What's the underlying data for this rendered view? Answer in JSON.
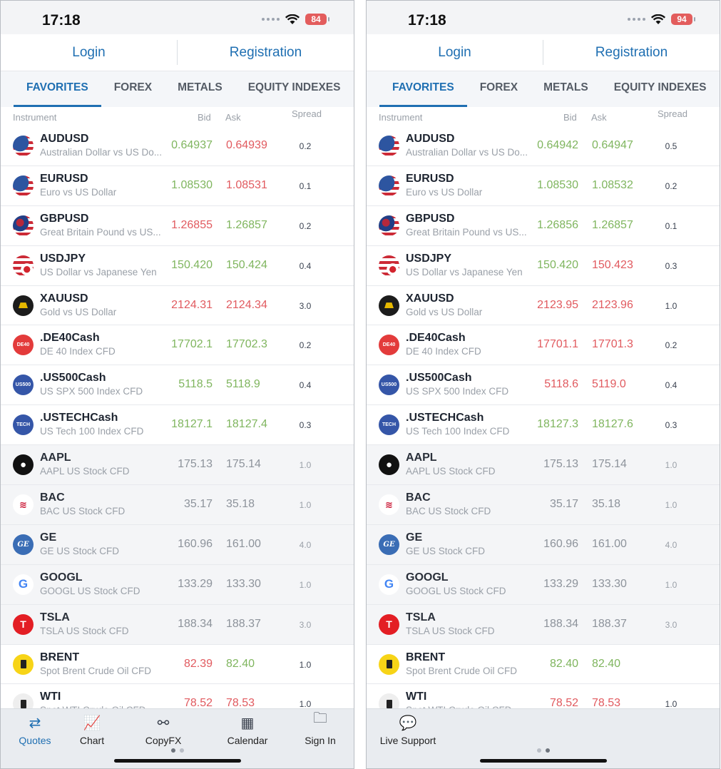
{
  "screens": [
    {
      "status": {
        "time": "17:18",
        "battery": "84"
      },
      "auth": {
        "login": "Login",
        "registration": "Registration"
      },
      "tabs": [
        "FAVORITES",
        "FOREX",
        "METALS",
        "EQUITY INDEXES"
      ],
      "columns": {
        "instrument": "Instrument",
        "bid": "Bid",
        "ask": "Ask",
        "spread": "Spread"
      },
      "rows": [
        {
          "icon": "usd-aud-flag-icon",
          "symbol": "AUDUSD",
          "desc": "Australian Dollar vs US Do...",
          "bid": "0.64937",
          "bid_dir": "up",
          "ask": "0.64939",
          "ask_dir": "down",
          "spread": "0.2"
        },
        {
          "icon": "eur-usd-flag-icon",
          "symbol": "EURUSD",
          "desc": "Euro vs US Dollar",
          "bid": "1.08530",
          "bid_dir": "up",
          "ask": "1.08531",
          "ask_dir": "down",
          "spread": "0.1"
        },
        {
          "icon": "gbp-usd-flag-icon",
          "symbol": "GBPUSD",
          "desc": "Great Britain Pound vs US...",
          "bid": "1.26855",
          "bid_dir": "down",
          "ask": "1.26857",
          "ask_dir": "up",
          "spread": "0.2"
        },
        {
          "icon": "usd-jpy-flag-icon",
          "symbol": "USDJPY",
          "desc": "US Dollar vs Japanese Yen",
          "bid": "150.420",
          "bid_dir": "up",
          "ask": "150.424",
          "ask_dir": "up",
          "spread": "0.4"
        },
        {
          "icon": "gold-bar-icon",
          "symbol": "XAUUSD",
          "desc": "Gold vs US Dollar",
          "bid": "2124.31",
          "bid_dir": "down",
          "ask": "2124.34",
          "ask_dir": "down",
          "spread": "3.0"
        },
        {
          "icon": "de40-index-icon",
          "symbol": ".DE40Cash",
          "desc": "DE 40 Index CFD",
          "bid": "17702.1",
          "bid_dir": "up",
          "ask": "17702.3",
          "ask_dir": "up",
          "spread": "0.2"
        },
        {
          "icon": "us500-index-icon",
          "symbol": ".US500Cash",
          "desc": "US SPX 500 Index CFD",
          "bid": "5118.5",
          "bid_dir": "up",
          "ask": "5118.9",
          "ask_dir": "up",
          "spread": "0.4"
        },
        {
          "icon": "ustech-index-icon",
          "symbol": ".USTECHCash",
          "desc": "US Tech 100 Index CFD",
          "bid": "18127.1",
          "bid_dir": "up",
          "ask": "18127.4",
          "ask_dir": "up",
          "spread": "0.3"
        },
        {
          "icon": "apple-logo-icon",
          "symbol": "AAPL",
          "desc": "AAPL US Stock CFD",
          "bid": "175.13",
          "bid_dir": "flat",
          "ask": "175.14",
          "ask_dir": "flat",
          "spread": "1.0",
          "dim": true
        },
        {
          "icon": "bank-of-america-logo-icon",
          "symbol": "BAC",
          "desc": "BAC US Stock CFD",
          "bid": "35.17",
          "bid_dir": "flat",
          "ask": "35.18",
          "ask_dir": "flat",
          "spread": "1.0",
          "dim": true
        },
        {
          "icon": "ge-logo-icon",
          "symbol": "GE",
          "desc": "GE US Stock CFD",
          "bid": "160.96",
          "bid_dir": "flat",
          "ask": "161.00",
          "ask_dir": "flat",
          "spread": "4.0",
          "dim": true
        },
        {
          "icon": "google-logo-icon",
          "symbol": "GOOGL",
          "desc": "GOOGL US Stock CFD",
          "bid": "133.29",
          "bid_dir": "flat",
          "ask": "133.30",
          "ask_dir": "flat",
          "spread": "1.0",
          "dim": true
        },
        {
          "icon": "tesla-logo-icon",
          "symbol": "TSLA",
          "desc": "TSLA US Stock CFD",
          "bid": "188.34",
          "bid_dir": "flat",
          "ask": "188.37",
          "ask_dir": "flat",
          "spread": "3.0",
          "dim": true
        },
        {
          "icon": "oil-barrel-icon",
          "symbol": "BRENT",
          "desc": "Spot Brent Crude Oil CFD",
          "bid": "82.39",
          "bid_dir": "down",
          "ask": "82.40",
          "ask_dir": "up",
          "spread": "1.0"
        },
        {
          "icon": "oil-barrel-icon",
          "symbol": "WTI",
          "desc": "Spot WTI Crude Oil CFD",
          "bid": "78.52",
          "bid_dir": "down",
          "ask": "78.53",
          "ask_dir": "down",
          "spread": "1.0"
        }
      ],
      "nav": [
        {
          "icon": "quotes-arrows-icon",
          "glyph": "⇄",
          "label": "Quotes",
          "active": true
        },
        {
          "icon": "chart-icon",
          "glyph": "📈",
          "label": "Chart"
        },
        {
          "icon": "copyfx-network-icon",
          "glyph": "⚯",
          "label": "CopyFX"
        },
        {
          "icon": "calendar-icon",
          "glyph": "▦",
          "label": "Calendar"
        },
        {
          "icon": "sign-in-folder-icon",
          "glyph": "🗀",
          "label": "Sign In"
        }
      ],
      "page_index": 0
    },
    {
      "status": {
        "time": "17:18",
        "battery": "94"
      },
      "auth": {
        "login": "Login",
        "registration": "Registration"
      },
      "tabs": [
        "FAVORITES",
        "FOREX",
        "METALS",
        "EQUITY INDEXES"
      ],
      "columns": {
        "instrument": "Instrument",
        "bid": "Bid",
        "ask": "Ask",
        "spread": "Spread"
      },
      "rows": [
        {
          "icon": "usd-aud-flag-icon",
          "symbol": "AUDUSD",
          "desc": "Australian Dollar vs US Do...",
          "bid": "0.64942",
          "bid_dir": "up",
          "ask": "0.64947",
          "ask_dir": "up",
          "spread": "0.5"
        },
        {
          "icon": "eur-usd-flag-icon",
          "symbol": "EURUSD",
          "desc": "Euro vs US Dollar",
          "bid": "1.08530",
          "bid_dir": "up",
          "ask": "1.08532",
          "ask_dir": "up",
          "spread": "0.2"
        },
        {
          "icon": "gbp-usd-flag-icon",
          "symbol": "GBPUSD",
          "desc": "Great Britain Pound vs US...",
          "bid": "1.26856",
          "bid_dir": "up",
          "ask": "1.26857",
          "ask_dir": "up",
          "spread": "0.1"
        },
        {
          "icon": "usd-jpy-flag-icon",
          "symbol": "USDJPY",
          "desc": "US Dollar vs Japanese Yen",
          "bid": "150.420",
          "bid_dir": "up",
          "ask": "150.423",
          "ask_dir": "down",
          "spread": "0.3"
        },
        {
          "icon": "gold-bar-icon",
          "symbol": "XAUUSD",
          "desc": "Gold vs US Dollar",
          "bid": "2123.95",
          "bid_dir": "down",
          "ask": "2123.96",
          "ask_dir": "down",
          "spread": "1.0"
        },
        {
          "icon": "de40-index-icon",
          "symbol": ".DE40Cash",
          "desc": "DE 40 Index CFD",
          "bid": "17701.1",
          "bid_dir": "down",
          "ask": "17701.3",
          "ask_dir": "down",
          "spread": "0.2"
        },
        {
          "icon": "us500-index-icon",
          "symbol": ".US500Cash",
          "desc": "US SPX 500 Index CFD",
          "bid": "5118.6",
          "bid_dir": "down",
          "ask": "5119.0",
          "ask_dir": "down",
          "spread": "0.4"
        },
        {
          "icon": "ustech-index-icon",
          "symbol": ".USTECHCash",
          "desc": "US Tech 100 Index CFD",
          "bid": "18127.3",
          "bid_dir": "up",
          "ask": "18127.6",
          "ask_dir": "up",
          "spread": "0.3"
        },
        {
          "icon": "apple-logo-icon",
          "symbol": "AAPL",
          "desc": "AAPL US Stock CFD",
          "bid": "175.13",
          "bid_dir": "flat",
          "ask": "175.14",
          "ask_dir": "flat",
          "spread": "1.0",
          "dim": true
        },
        {
          "icon": "bank-of-america-logo-icon",
          "symbol": "BAC",
          "desc": "BAC US Stock CFD",
          "bid": "35.17",
          "bid_dir": "flat",
          "ask": "35.18",
          "ask_dir": "flat",
          "spread": "1.0",
          "dim": true
        },
        {
          "icon": "ge-logo-icon",
          "symbol": "GE",
          "desc": "GE US Stock CFD",
          "bid": "160.96",
          "bid_dir": "flat",
          "ask": "161.00",
          "ask_dir": "flat",
          "spread": "4.0",
          "dim": true
        },
        {
          "icon": "google-logo-icon",
          "symbol": "GOOGL",
          "desc": "GOOGL US Stock CFD",
          "bid": "133.29",
          "bid_dir": "flat",
          "ask": "133.30",
          "ask_dir": "flat",
          "spread": "1.0",
          "dim": true
        },
        {
          "icon": "tesla-logo-icon",
          "symbol": "TSLA",
          "desc": "TSLA US Stock CFD",
          "bid": "188.34",
          "bid_dir": "flat",
          "ask": "188.37",
          "ask_dir": "flat",
          "spread": "3.0",
          "dim": true
        },
        {
          "icon": "oil-barrel-icon",
          "symbol": "BRENT",
          "desc": "Spot Brent Crude Oil CFD",
          "bid": "82.40",
          "bid_dir": "up",
          "ask": "82.40",
          "ask_dir": "up",
          "spread": ""
        },
        {
          "icon": "oil-barrel-icon",
          "symbol": "WTI",
          "desc": "Spot WTI Crude Oil CFD",
          "bid": "78.52",
          "bid_dir": "down",
          "ask": "78.53",
          "ask_dir": "down",
          "spread": "1.0"
        }
      ],
      "nav": [
        {
          "icon": "live-support-chat-icon",
          "glyph": "💬",
          "label": "Live Support"
        }
      ],
      "page_index": 1
    }
  ],
  "colors": {
    "accent": "#1f6fb2",
    "price_up": "#7fb55e",
    "price_down": "#e15a5f",
    "price_flat": "#8d939b",
    "battery": "#e35d5d"
  }
}
